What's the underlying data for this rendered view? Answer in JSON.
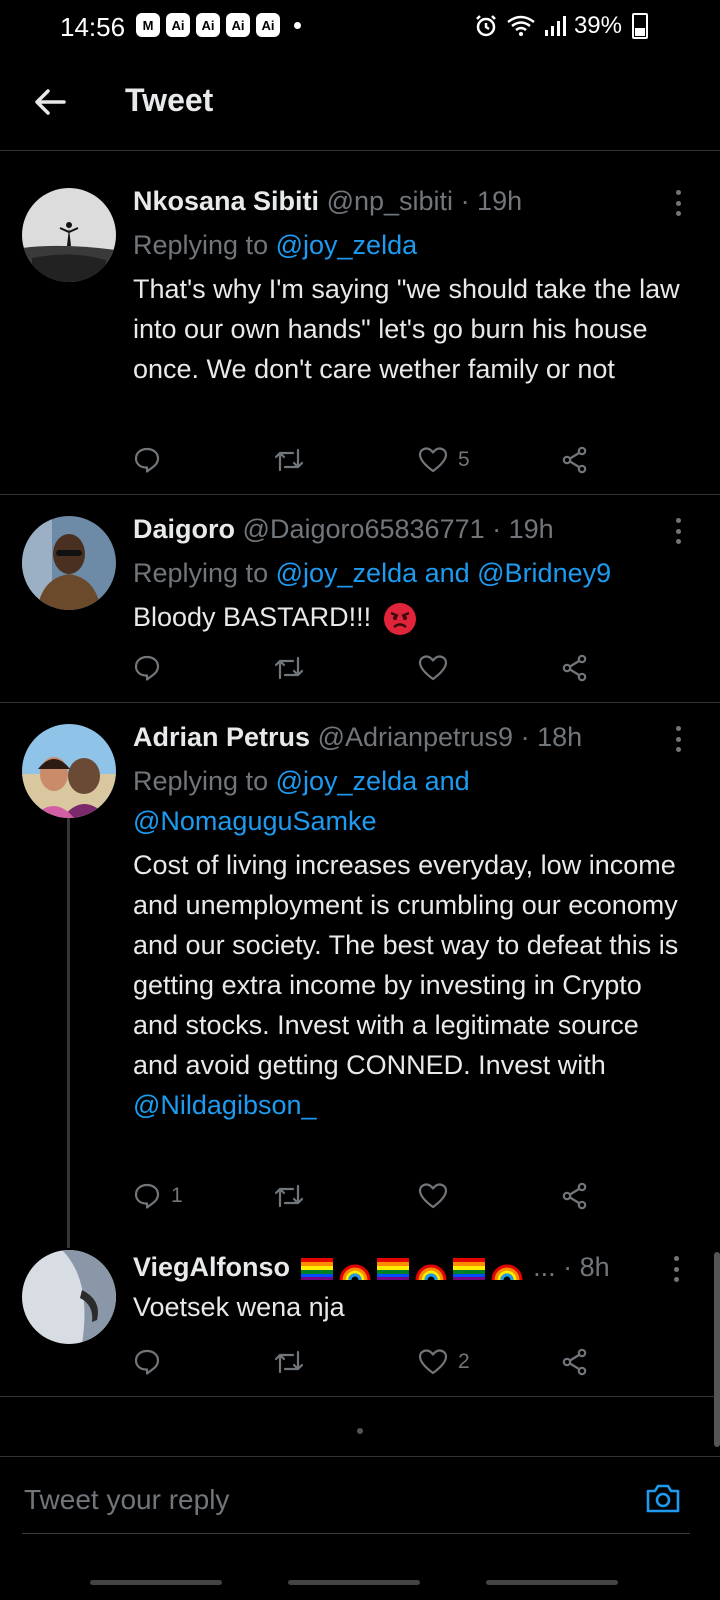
{
  "status_bar": {
    "time": "14:56",
    "apps": [
      "M",
      "Ai",
      "Ai",
      "Ai",
      "Ai"
    ],
    "battery": "39%",
    "icons": [
      "alarm-icon",
      "wifi-icon",
      "signal-icon",
      "battery-icon"
    ]
  },
  "header": {
    "title": "Tweet"
  },
  "tweets": [
    {
      "name": "Nkosana Sibiti",
      "handle": "@np_sibiti",
      "time": "· 19h",
      "replying_prefix": "Replying to",
      "mentions": "@joy_zelda",
      "body": "That's why I'm saying \"we should take the law into our own hands\" let's go burn his house once. We don't care wether family or not",
      "replies": "",
      "retweets": "",
      "likes": "5"
    },
    {
      "name": "Daigoro",
      "handle": "@Daigoro65836771",
      "time": "· 19h",
      "replying_prefix": "Replying to",
      "mentions": "@joy_zelda and @Bridney9",
      "body": "Bloody BASTARD!!!",
      "replies": "",
      "retweets": "",
      "likes": ""
    },
    {
      "name": "Adrian Petrus",
      "handle": "@Adrianpetrus9",
      "time": "· 18h",
      "replying_prefix": "Replying to",
      "mentions_line1": "@joy_zelda and",
      "mentions_line2": "@NomaguguSamke",
      "body": "Cost of living increases everyday, low income and unemployment is crumbling our economy and our society. The best way to defeat this is getting extra income by investing in Crypto and stocks. Invest with a legitimate source and avoid getting CONNED. Invest with",
      "body_mention": "@Nildagibson_",
      "replies": "1",
      "retweets": "",
      "likes": ""
    },
    {
      "name": "ViegAlfonso",
      "handle": "...",
      "time": "· 8h",
      "body": "Voetsek wena nja",
      "replies": "",
      "retweets": "",
      "likes": "2"
    }
  ],
  "reply_bar": {
    "placeholder": "Tweet your reply"
  },
  "colors": {
    "background": "#000000",
    "accent": "#1d9bf0",
    "muted": "#71767b",
    "divider": "#2f3336"
  }
}
